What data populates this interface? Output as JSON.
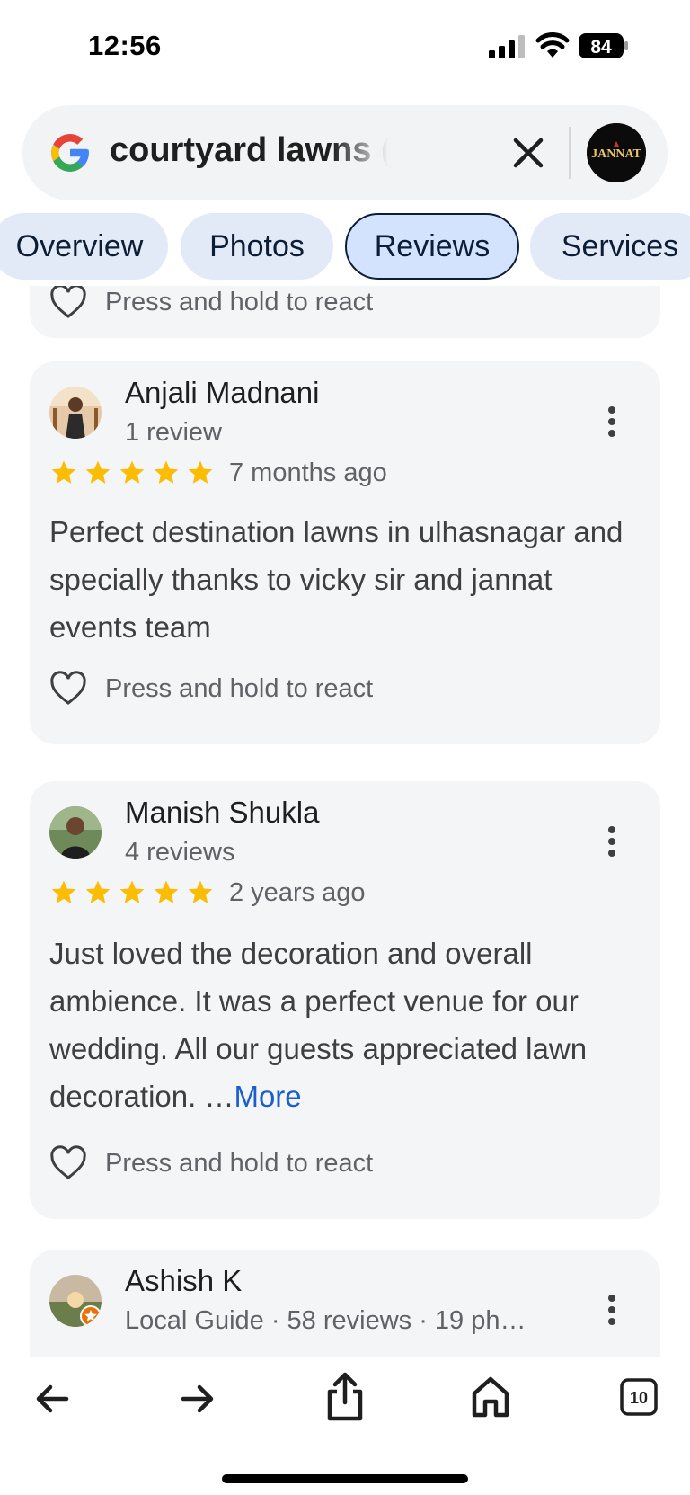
{
  "status_bar": {
    "time": "12:56",
    "battery": "84"
  },
  "search": {
    "query": "courtyard lawns (ma…",
    "account_badge_text": "JANNAT"
  },
  "tabs": [
    {
      "label": "Overview",
      "active": false
    },
    {
      "label": "Photos",
      "active": false
    },
    {
      "label": "Reviews",
      "active": true
    },
    {
      "label": "Services",
      "active": false
    }
  ],
  "partial_card": {
    "react_text": "Press and hold to react"
  },
  "reviews": [
    {
      "name": "Anjali Madnani",
      "meta": "1 review",
      "rating": 5,
      "time_ago": "7 months ago",
      "text": "Perfect destination lawns in ulhasnagar and specially thanks to vicky sir and jannat events team",
      "react_text": "Press and hold to react"
    },
    {
      "name": "Manish Shukla",
      "meta": "4 reviews",
      "rating": 5,
      "time_ago": "2 years ago",
      "text": "Just loved the decoration and overall ambience. It was a perfect venue for our wedding. All our guests appreciated lawn decoration. …",
      "more_label": "More",
      "react_text": "Press and hold to react"
    },
    {
      "name": "Ashish K",
      "meta": "Local Guide · 58 reviews · 19 ph…"
    }
  ],
  "bottom_nav": {
    "tab_count": "10"
  },
  "colors": {
    "star": "#fbbc04",
    "link": "#1a5fd0",
    "card_bg": "#f4f5f6",
    "tab_bg": "#e2e9f7"
  }
}
